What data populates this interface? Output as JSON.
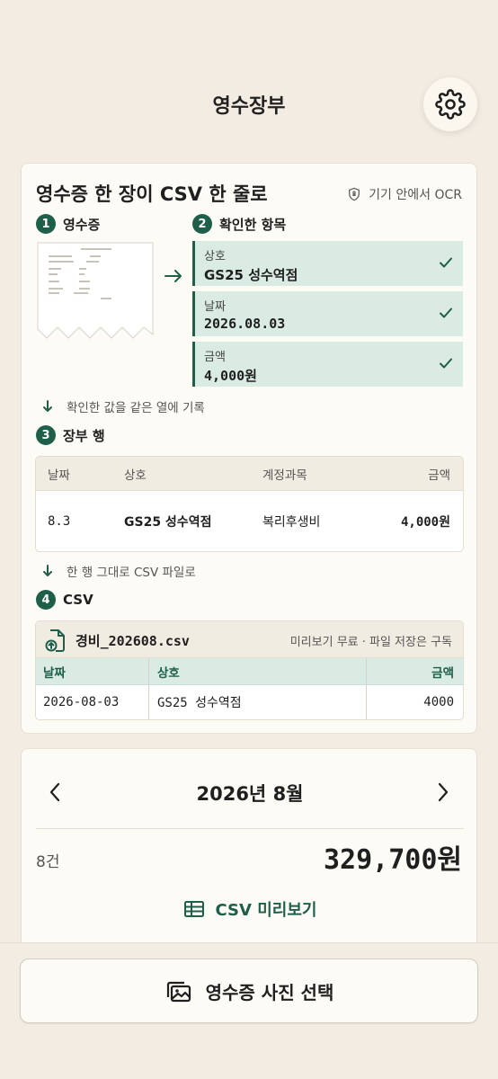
{
  "header": {
    "title": "영수장부",
    "settings_icon": "gear-icon"
  },
  "flow": {
    "title": "영수증 한 장이 CSV 한 줄로",
    "ocr_note": "기기 안에서 OCR",
    "step1": {
      "num": "1",
      "label": "영수증"
    },
    "step2": {
      "num": "2",
      "label": "확인한 항목"
    },
    "step3": {
      "num": "3",
      "label": "장부 행"
    },
    "step4": {
      "num": "4",
      "label": "CSV"
    },
    "fields": [
      {
        "label": "상호",
        "value": "GS25 성수역점"
      },
      {
        "label": "날짜",
        "value": "2026.08.03"
      },
      {
        "label": "금액",
        "value": "4,000원"
      }
    ],
    "note1": "확인한 값을 같은 열에 기록",
    "note2": "한 행 그대로 CSV 파일로",
    "ledger": {
      "headers": [
        "날짜",
        "상호",
        "계정과목",
        "금액"
      ],
      "row": [
        "8.3",
        "GS25 성수역점",
        "복리후생비",
        "4,000원"
      ]
    },
    "csv": {
      "file_name": "경비_202608.csv",
      "hint": "미리보기 무료 · 파일 저장은 구독",
      "headers": [
        "날짜",
        "상호",
        "금액"
      ],
      "row": [
        "2026-08-03",
        "GS25 성수역점",
        "4000"
      ]
    }
  },
  "month": {
    "label": "2026년 8월",
    "count": "8건",
    "total": "329,700원",
    "csv_preview_label": "CSV 미리보기"
  },
  "bottom": {
    "select_label": "영수증 사진 선택"
  },
  "colors": {
    "accent": "#1f5f4a",
    "field_bg": "#d9ebe3",
    "page_bg": "#f3ece2",
    "card_bg": "#fdfbf6"
  }
}
